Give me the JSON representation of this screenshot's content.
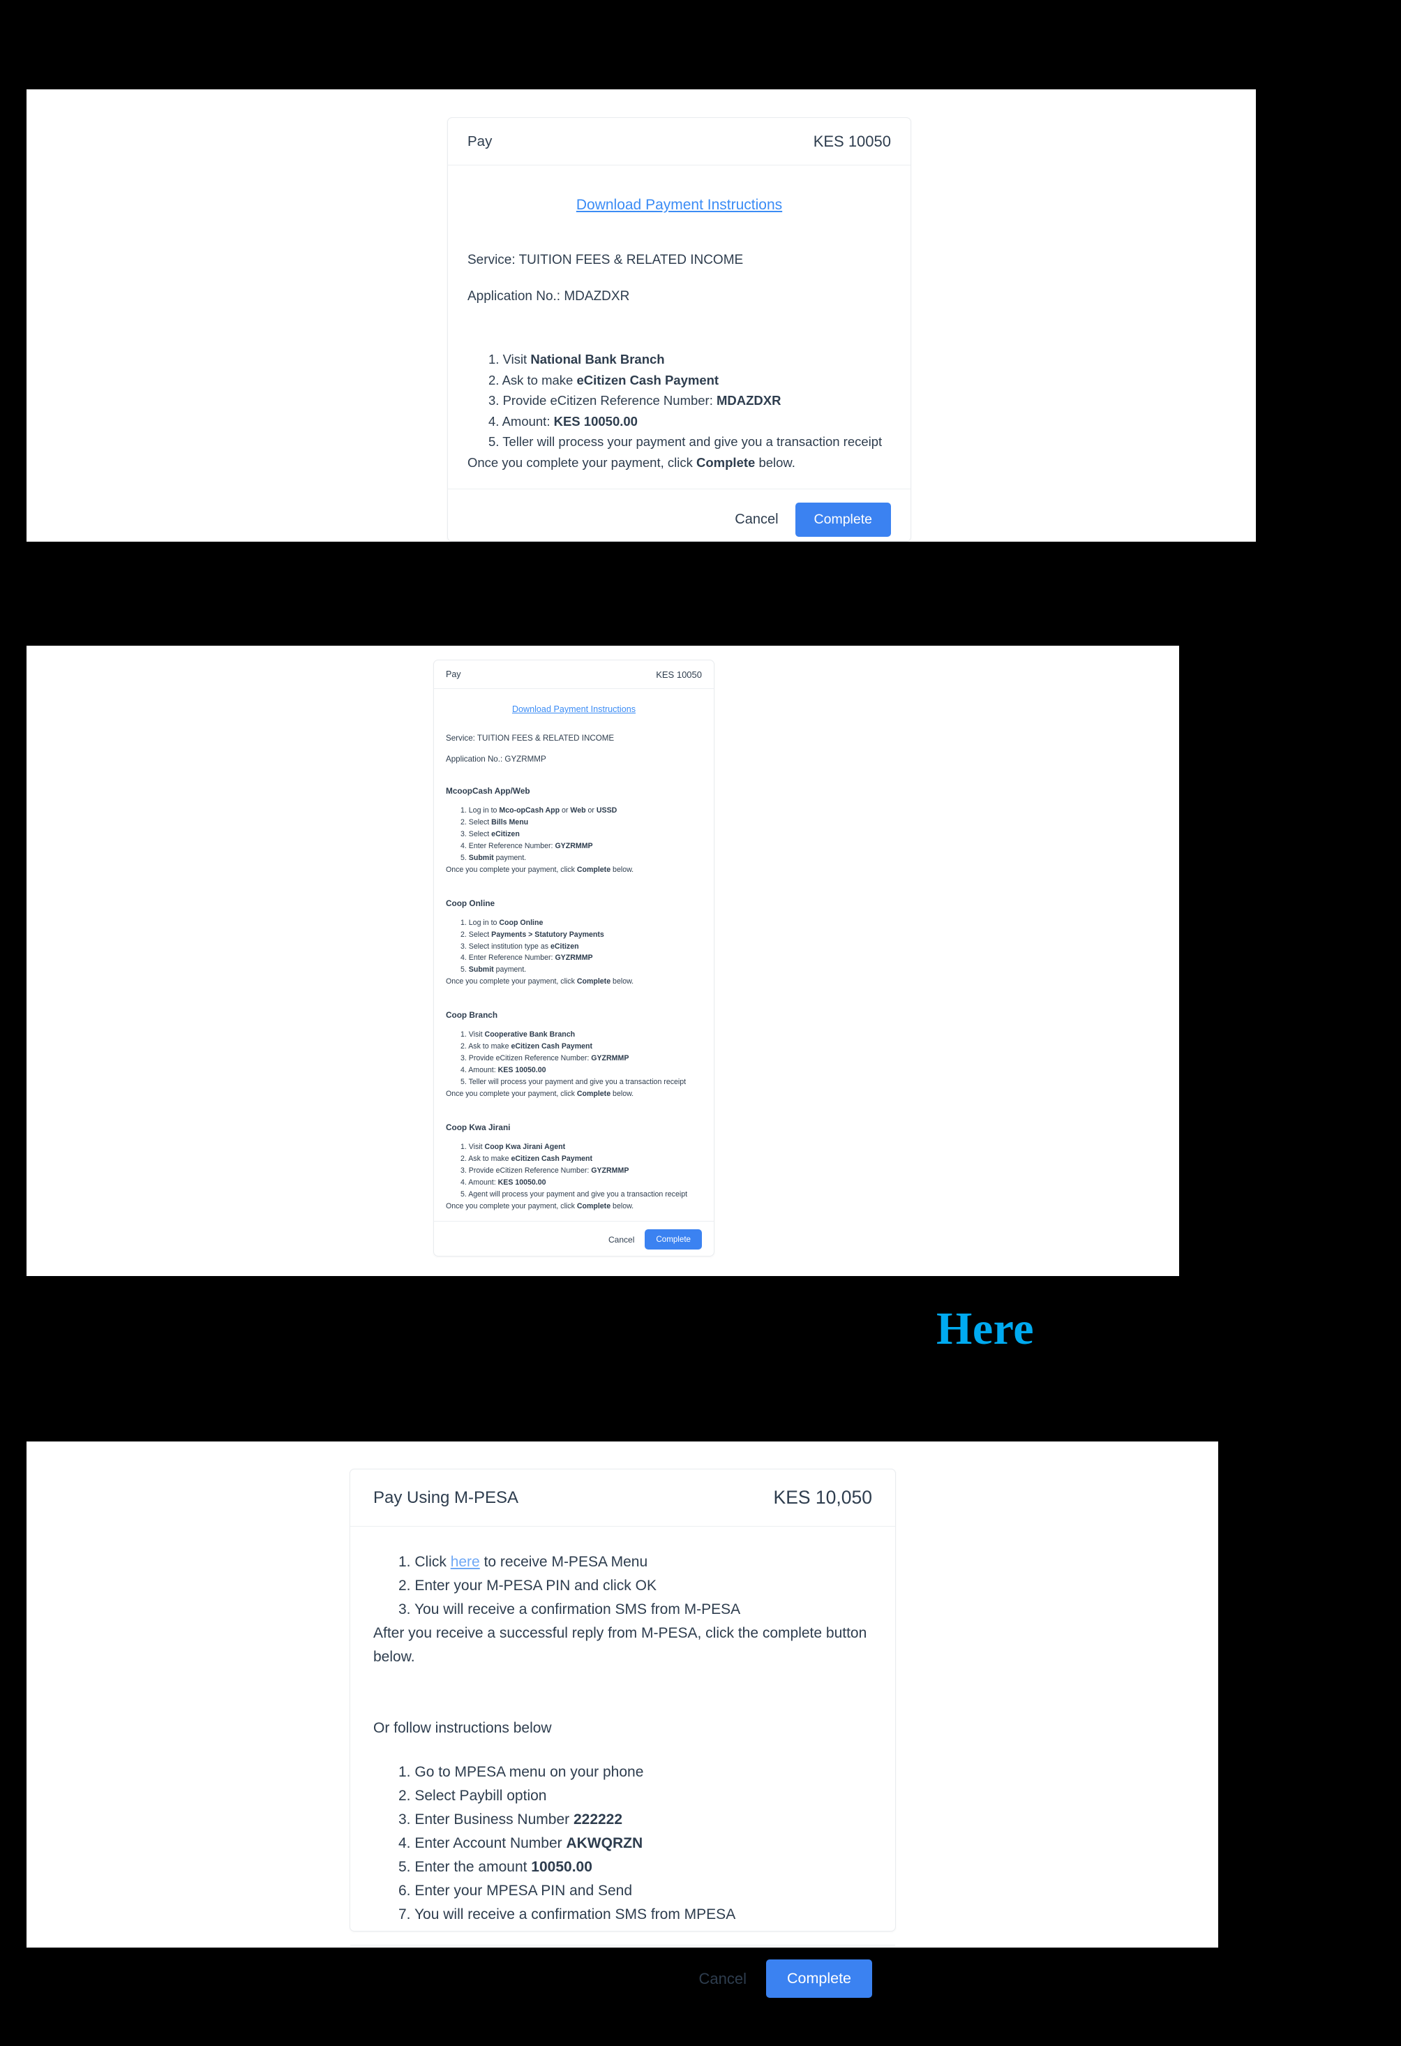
{
  "theme": {
    "page_background": "#000000",
    "capture_background": "#ffffff",
    "card_background": "#ffffff",
    "text_color": "#2e3d4e",
    "link_color": "#3b8cf5",
    "inline_link_color": "#6fa8f5",
    "accent_button": "#3b82f1",
    "here_color": "#00aaf0",
    "divider_color": "#eceff1"
  },
  "panel1": {
    "header": {
      "title": "Pay",
      "amount": "KES 10050"
    },
    "download_link": "Download Payment Instructions",
    "service_line": "Service: TUITION FEES & RELATED INCOME",
    "application_line": "Application No.: MDAZDXR",
    "reference": "MDAZDXR",
    "steps": [
      {
        "num": "1.",
        "pre": "Visit ",
        "bold": "National Bank Branch",
        "post": ""
      },
      {
        "num": "2.",
        "pre": "Ask to make ",
        "bold": "eCitizen Cash Payment",
        "post": ""
      },
      {
        "num": "3.",
        "pre": "Provide eCitizen Reference Number: ",
        "bold": "MDAZDXR",
        "post": ""
      },
      {
        "num": "4.",
        "pre": "Amount: ",
        "bold": "KES 10050.00",
        "post": ""
      },
      {
        "num": "5.",
        "pre": "Teller will process your payment and give you a transaction receipt",
        "bold": "",
        "post": ""
      }
    ],
    "tail_pre": "Once you complete your payment, click ",
    "tail_bold": "Complete",
    "tail_post": " below.",
    "footer": {
      "cancel": "Cancel",
      "complete": "Complete"
    }
  },
  "panel2": {
    "header": {
      "title": "Pay",
      "amount": "KES 10050"
    },
    "download_link": "Download Payment Instructions",
    "service_line": "Service: TUITION FEES & RELATED INCOME",
    "application_line": "Application No.: GYZRMMP",
    "reference": "GYZRMMP",
    "tail_pre": "Once you complete your payment, click ",
    "tail_bold": "Complete",
    "tail_post": " below.",
    "sections": [
      {
        "title": "McoopCash App/Web",
        "steps": [
          {
            "num": "1.",
            "pre": "Log in to ",
            "bold": "Mco-opCash App",
            "mid": " or ",
            "bold2": "Web",
            "mid2": " or ",
            "bold3": "USSD",
            "post": ""
          },
          {
            "num": "2.",
            "pre": "Select ",
            "bold": "Bills Menu",
            "post": ""
          },
          {
            "num": "3.",
            "pre": "Select ",
            "bold": "eCitizen",
            "post": ""
          },
          {
            "num": "4.",
            "pre": "Enter Reference Number: ",
            "bold": "GYZRMMP",
            "post": ""
          },
          {
            "num": "5.",
            "pre": "",
            "bold": "Submit",
            "post": " payment."
          }
        ]
      },
      {
        "title": "Coop Online",
        "steps": [
          {
            "num": "1.",
            "pre": "Log in to ",
            "bold": "Coop Online",
            "post": ""
          },
          {
            "num": "2.",
            "pre": "Select ",
            "bold": "Payments > Statutory Payments",
            "post": ""
          },
          {
            "num": "3.",
            "pre": "Select institution type as ",
            "bold": "eCitizen",
            "post": ""
          },
          {
            "num": "4.",
            "pre": "Enter Reference Number: ",
            "bold": "GYZRMMP",
            "post": ""
          },
          {
            "num": "5.",
            "pre": "",
            "bold": "Submit",
            "post": " payment."
          }
        ]
      },
      {
        "title": "Coop Branch",
        "steps": [
          {
            "num": "1.",
            "pre": "Visit ",
            "bold": "Cooperative Bank Branch",
            "post": ""
          },
          {
            "num": "2.",
            "pre": "Ask to make ",
            "bold": "eCitizen Cash Payment",
            "post": ""
          },
          {
            "num": "3.",
            "pre": "Provide eCitizen Reference Number: ",
            "bold": "GYZRMMP",
            "post": ""
          },
          {
            "num": "4.",
            "pre": "Amount: ",
            "bold": "KES 10050.00",
            "post": ""
          },
          {
            "num": "5.",
            "pre": "Teller will process your payment and give you a transaction receipt",
            "bold": "",
            "post": ""
          }
        ]
      },
      {
        "title": "Coop Kwa Jirani",
        "steps": [
          {
            "num": "1.",
            "pre": "Visit ",
            "bold": "Coop Kwa Jirani Agent",
            "post": ""
          },
          {
            "num": "2.",
            "pre": "Ask to make ",
            "bold": "eCitizen Cash Payment",
            "post": ""
          },
          {
            "num": "3.",
            "pre": "Provide eCitizen Reference Number: ",
            "bold": "GYZRMMP",
            "post": ""
          },
          {
            "num": "4.",
            "pre": "Amount: ",
            "bold": "KES 10050.00",
            "post": ""
          },
          {
            "num": "5.",
            "pre": "Agent will process your payment and give you a transaction receipt",
            "bold": "",
            "post": ""
          }
        ]
      }
    ],
    "footer": {
      "cancel": "Cancel",
      "complete": "Complete"
    }
  },
  "panel3": {
    "header": {
      "title": "Pay Using M-PESA",
      "amount": "KES 10,050"
    },
    "steps_primary": [
      {
        "num": "1.",
        "pre": "Click ",
        "link": "here",
        "post": " to receive M-PESA Menu"
      },
      {
        "num": "2.",
        "pre": "Enter your M-PESA PIN and click OK",
        "link": "",
        "post": ""
      },
      {
        "num": "3.",
        "pre": "You will receive a confirmation SMS from M-PESA",
        "link": "",
        "post": ""
      }
    ],
    "tail_primary": "After you receive a successful reply from M-PESA, click the complete button below.",
    "subheading": "Or follow instructions below",
    "steps_secondary": [
      {
        "num": "1.",
        "pre": "Go to MPESA menu on your phone",
        "bold": "",
        "post": ""
      },
      {
        "num": "2.",
        "pre": "Select Paybill option",
        "bold": "",
        "post": ""
      },
      {
        "num": "3.",
        "pre": "Enter Business Number ",
        "bold": "222222",
        "post": ""
      },
      {
        "num": "4.",
        "pre": "Enter Account Number ",
        "bold": "AKWQRZN",
        "post": ""
      },
      {
        "num": "5.",
        "pre": "Enter the amount ",
        "bold": "10050.00",
        "post": ""
      },
      {
        "num": "6.",
        "pre": "Enter your MPESA PIN and Send",
        "bold": "",
        "post": ""
      },
      {
        "num": "7.",
        "pre": "You will receive a confirmation SMS from MPESA",
        "bold": "",
        "post": ""
      }
    ],
    "business_number": "222222",
    "account_number": "AKWQRZN",
    "amount_value": "10050.00",
    "footer": {
      "cancel": "Cancel",
      "complete": "Complete"
    }
  },
  "annotation": {
    "here_word": "Here"
  }
}
